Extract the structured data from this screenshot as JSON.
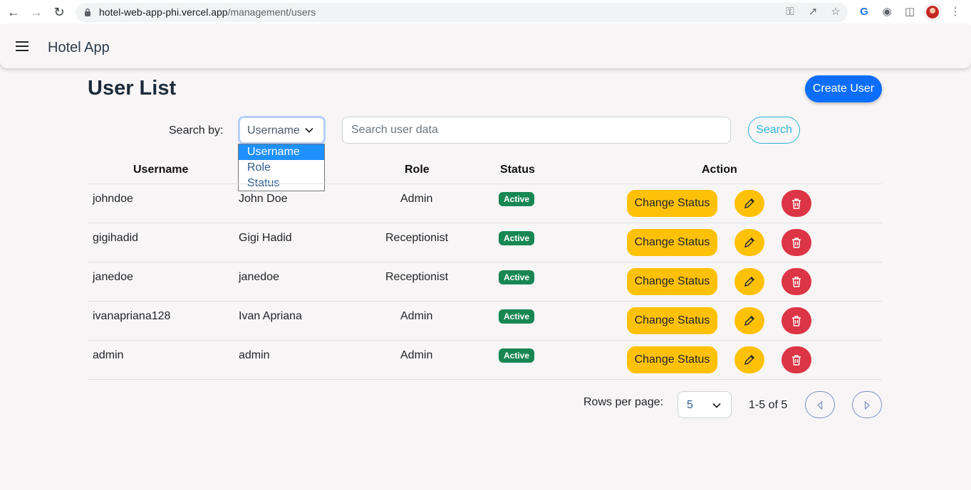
{
  "browser": {
    "url_domain": "hotel-web-app-phi.vercel.app",
    "url_path": "/management/users",
    "icons": [
      "back-icon",
      "forward-icon",
      "reload-icon",
      "lock-icon",
      "key-icon",
      "share-icon",
      "star-icon",
      "translate-icon",
      "extensions-icon",
      "sidepanel-icon",
      "profile-avatar",
      "menu-dots-icon"
    ]
  },
  "appbar": {
    "title": "Hotel App"
  },
  "page": {
    "title": "User List",
    "create_button": "Create User"
  },
  "search": {
    "label": "Search by:",
    "selected": "Username",
    "options": [
      "Username",
      "Role",
      "Status"
    ],
    "placeholder": "Search user data",
    "button": "Search"
  },
  "table": {
    "headers": [
      "Username",
      "Role",
      "Status",
      "Action"
    ],
    "rows": [
      {
        "username": "johndoe",
        "name": "John Doe",
        "role": "Admin",
        "status": "Active"
      },
      {
        "username": "gigihadid",
        "name": "Gigi Hadid",
        "role": "Receptionist",
        "status": "Active"
      },
      {
        "username": "janedoe",
        "name": "janedoe",
        "role": "Receptionist",
        "status": "Active"
      },
      {
        "username": "ivanapriana128",
        "name": "Ivan Apriana",
        "role": "Admin",
        "status": "Active"
      },
      {
        "username": "admin",
        "name": "admin",
        "role": "Admin",
        "status": "Active"
      }
    ],
    "change_status_label": "Change Status"
  },
  "pagination": {
    "rows_label": "Rows per page:",
    "rows_value": "5",
    "range": "1-5 of 5"
  },
  "colors": {
    "primary": "#0d6efd",
    "warning": "#ffc107",
    "danger": "#dc3545",
    "success": "#198754",
    "info": "#2bb5d8"
  }
}
